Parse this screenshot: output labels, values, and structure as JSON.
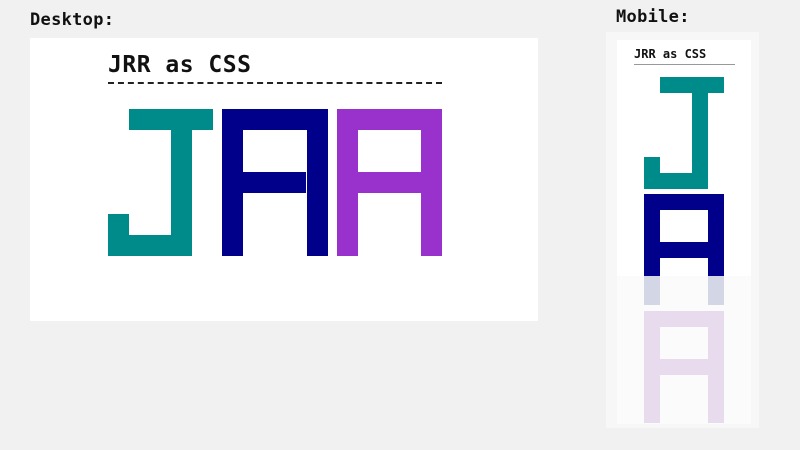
{
  "labels": {
    "desktop": "Desktop:",
    "mobile": "Mobile:"
  },
  "desktop": {
    "title": "JRR as CSS"
  },
  "mobile": {
    "title": "JRR as CSS"
  },
  "colors": {
    "page_background": "#f1f1f1",
    "frame_background": "#ffffff",
    "letter_J": "#008b8b",
    "letter_R1": "#00008b",
    "letter_R2": "#9932cc",
    "overflow_R1": "#d3d6e4",
    "overflow_R2": "#e8dbed"
  },
  "letters": [
    "J",
    "R",
    "R"
  ]
}
